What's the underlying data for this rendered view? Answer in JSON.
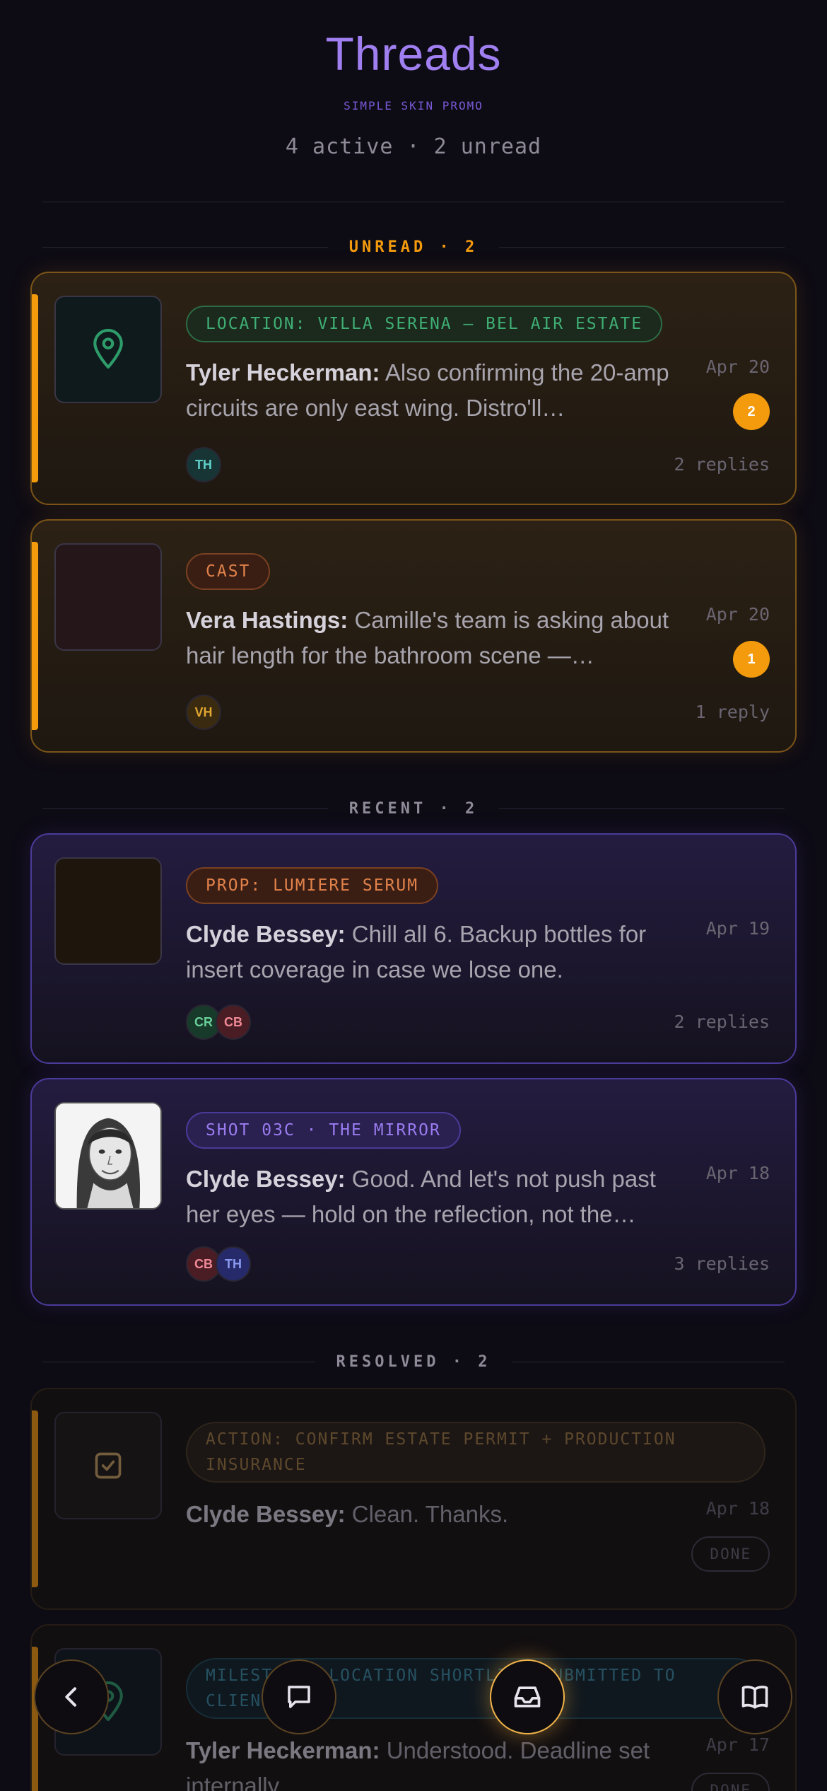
{
  "header": {
    "title": "Threads",
    "subtitle": "SIMPLE SKIN PROMO",
    "counts": "4 active · 2 unread"
  },
  "sections": {
    "unread": "UNREAD · 2",
    "recent": "RECENT · 2",
    "resolved": "RESOLVED · 2"
  },
  "threads": [
    {
      "tag": "LOCATION: VILLA SERENA — BEL AIR ESTATE",
      "author": "Tyler Heckerman:",
      "text": "Also confirming the 20-amp circuits are only east wing. Distro'll…",
      "date": "Apr 20",
      "unread_count": "2",
      "replies": "2 replies",
      "avatars": [
        "TH"
      ],
      "thumb_icon": "map-pin-icon"
    },
    {
      "tag": "CAST",
      "author": "Vera Hastings:",
      "text": "Camille's team is asking about hair length for the bathroom scene —…",
      "date": "Apr 20",
      "unread_count": "1",
      "replies": "1 reply",
      "avatars": [
        "VH"
      ]
    },
    {
      "tag": "PROP: LUMIERE SERUM",
      "author": "Clyde Bessey:",
      "text": "Chill all 6. Backup bottles for insert coverage in case we lose one.",
      "date": "Apr 19",
      "replies": "2 replies",
      "avatars": [
        "CR",
        "CB"
      ]
    },
    {
      "tag": "SHOT 03C · THE MIRROR",
      "author": "Clyde Bessey:",
      "text": "Good. And let's not push past her eyes — hold on the reflection, not the…",
      "date": "Apr 18",
      "replies": "3 replies",
      "avatars": [
        "CB",
        "TH"
      ],
      "thumb_icon": "portrait-sketch-image"
    },
    {
      "tag": "ACTION: CONFIRM ESTATE PERMIT + PRODUCTION INSURANCE",
      "author": "Clyde Bessey:",
      "text": "Clean. Thanks.",
      "date": "Apr 18",
      "status": "DONE",
      "thumb_icon": "checkbox-icon"
    },
    {
      "tag": "MILESTONE: LOCATION SHORTLIST SUBMITTED TO CLIENT",
      "author": "Tyler Heckerman:",
      "text": "Understood. Deadline set internally.",
      "date": "Apr 17",
      "status": "DONE",
      "thumb_icon": "map-pin-icon"
    }
  ],
  "nav": [
    "back-icon",
    "chat-icon",
    "inbox-icon",
    "book-icon"
  ],
  "colors": {
    "accent": "#f39a0d",
    "brand": "#a07ff0",
    "background": "#0d0b14"
  }
}
